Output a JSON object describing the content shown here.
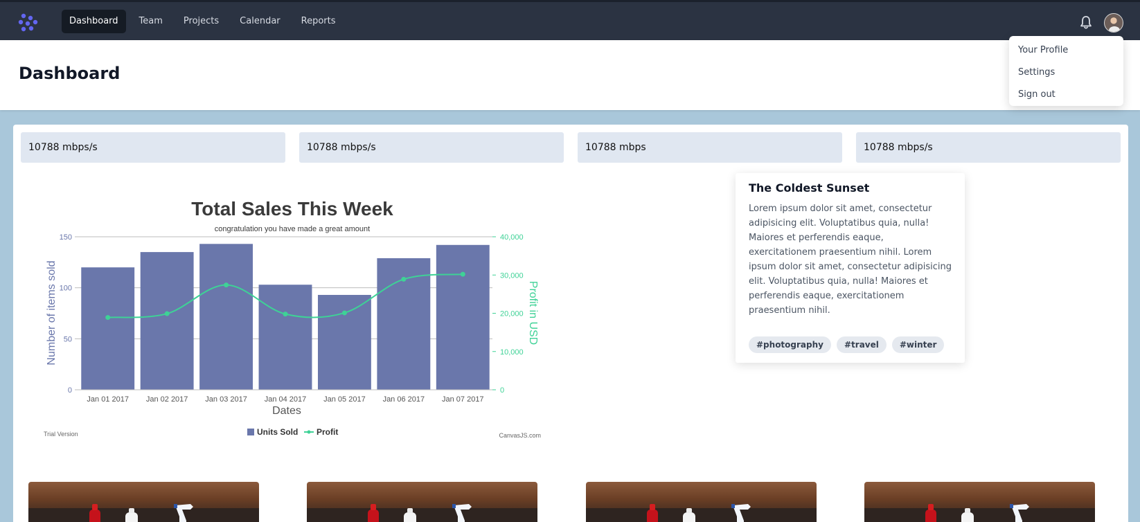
{
  "nav": {
    "items": [
      {
        "label": "Dashboard",
        "active": true
      },
      {
        "label": "Team"
      },
      {
        "label": "Projects"
      },
      {
        "label": "Calendar"
      },
      {
        "label": "Reports"
      }
    ],
    "icons": {
      "logo": "logo-icon",
      "notifications": "bell-icon",
      "avatar": "user-avatar"
    }
  },
  "profile_menu": {
    "items": [
      "Your Profile",
      "Settings",
      "Sign out"
    ]
  },
  "header": {
    "title": "Dashboard"
  },
  "stats": [
    {
      "value": "10788 mbps/s"
    },
    {
      "value": "10788 mbps/s"
    },
    {
      "value": "10788 mbps"
    },
    {
      "value": "10788 mbps/s"
    }
  ],
  "chart_data": {
    "type": "bar",
    "title": "Total Sales This Week",
    "subtitle": "congratulation you have made a great amount",
    "xlabel": "Dates",
    "ylabel": "Number of items sold",
    "y2label": "Profit in USD",
    "categories": [
      "Jan 01 2017",
      "Jan 02 2017",
      "Jan 03 2017",
      "Jan 04 2017",
      "Jan 05 2017",
      "Jan 06 2017",
      "Jan 07 2017"
    ],
    "ylim": [
      0,
      150
    ],
    "y2lim": [
      0,
      40000
    ],
    "yticks": [
      "0",
      "50",
      "100",
      "150"
    ],
    "y2ticks": [
      "0",
      "10,000",
      "20,000",
      "30,000",
      "40,000"
    ],
    "series": [
      {
        "name": "Units Sold",
        "type": "bar",
        "color": "#6a77ab",
        "values": [
          120,
          135,
          143,
          103,
          93,
          129,
          142
        ]
      },
      {
        "name": "Profit",
        "type": "line",
        "axis": "y2",
        "color": "#3ed296",
        "values": [
          18900,
          19900,
          27400,
          19800,
          20100,
          28900,
          30200
        ]
      }
    ],
    "grid": true,
    "legend": "bottom",
    "footer_left": "Trial Version",
    "footer_right": "CanvasJS.com"
  },
  "card": {
    "title": "The Coldest Sunset",
    "body": "Lorem ipsum dolor sit amet, consectetur adipisicing elit. Voluptatibus quia, nulla! Maiores et perferendis eaque, exercitationem praesentium nihil. Lorem ipsum dolor sit amet, consectetur adipisicing elit. Voluptatibus quia, nulla! Maiores et perferendis eaque, exercitationem praesentium nihil.",
    "tags": [
      "#photography",
      "#travel",
      "#winter"
    ]
  }
}
